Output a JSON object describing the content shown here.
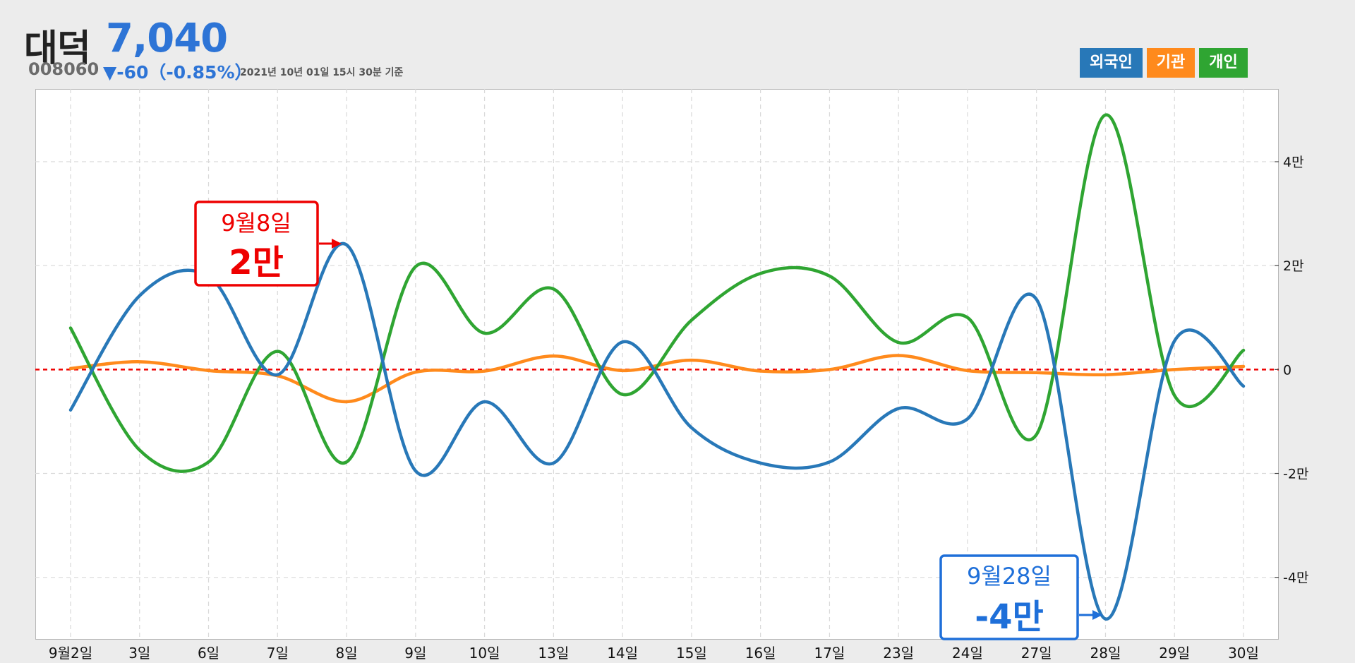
{
  "stock": {
    "name": "대덕",
    "price": "7,040",
    "code": "008060",
    "change": "▼-60（-0.85%）",
    "date_note": "2021년 10년 01일 15시 30분 기준"
  },
  "legend": [
    {
      "label": "외국인",
      "color": "#2878b8"
    },
    {
      "label": "기관",
      "color": "#ff8a1c"
    },
    {
      "label": "개인",
      "color": "#2fa532"
    }
  ],
  "callouts": {
    "max": {
      "date": "9월8일",
      "value": "2만",
      "color": "#ee0000"
    },
    "min": {
      "date": "9월28일",
      "value": "-4만",
      "color": "#1e6fd9"
    }
  },
  "chart_data": {
    "type": "line",
    "categories": [
      "9월2일",
      "3일",
      "6일",
      "7일",
      "8일",
      "9일",
      "10일",
      "13일",
      "14일",
      "15일",
      "16일",
      "17일",
      "23일",
      "24일",
      "27일",
      "28일",
      "29일",
      "30일"
    ],
    "series": [
      {
        "name": "외국인",
        "color": "#2878b8",
        "values": [
          -7800,
          14200,
          18000,
          -1000,
          24000,
          -19500,
          -6200,
          -18000,
          5300,
          -11200,
          -18000,
          -17800,
          -7500,
          -9500,
          13500,
          -48000,
          5500,
          -3200
        ]
      },
      {
        "name": "기관",
        "color": "#ff8a1c",
        "values": [
          200,
          1500,
          -200,
          -1200,
          -6200,
          -500,
          -300,
          2600,
          -200,
          1800,
          -300,
          0,
          2700,
          -200,
          -600,
          -1000,
          0,
          600
        ]
      },
      {
        "name": "개인",
        "color": "#2fa532",
        "values": [
          8000,
          -15500,
          -17800,
          3500,
          -17800,
          19800,
          7000,
          15500,
          -4800,
          9500,
          18500,
          18000,
          5200,
          10000,
          -12500,
          49000,
          -5000,
          3700
        ]
      }
    ],
    "yticks": [
      {
        "value": 40000,
        "label": "4만"
      },
      {
        "value": 20000,
        "label": "2만"
      },
      {
        "value": 0,
        "label": "0"
      },
      {
        "value": -20000,
        "label": "-2만"
      },
      {
        "value": -40000,
        "label": "-4만"
      }
    ],
    "ylim": [
      -52000,
      54000
    ],
    "grid": true,
    "zero_line": true,
    "legend_position": "top-right"
  }
}
